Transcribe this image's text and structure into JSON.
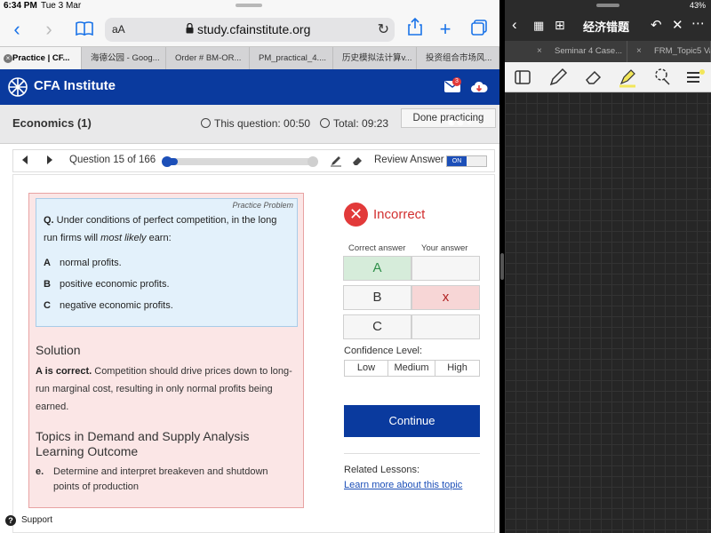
{
  "status_bar": {
    "time": "6:34 PM",
    "date": "Tue 3 Mar",
    "battery": "43%"
  },
  "browser": {
    "address_aa": "aA",
    "url": "study.cfainstitute.org",
    "tabs": [
      {
        "label": "Practice | CF..."
      },
      {
        "label": "海德公园 - Goog..."
      },
      {
        "label": "Order # BM-OR..."
      },
      {
        "label": "PM_practical_4...."
      },
      {
        "label": "历史模拟法计算v..."
      },
      {
        "label": "投资组合市场风..."
      }
    ]
  },
  "site": {
    "brand": "CFA Institute",
    "mail_badge": "3",
    "section_title": "Economics (1)",
    "this_question": "This question: 00:50",
    "total": "Total: 09:23",
    "done_label": "Done practicing"
  },
  "question_nav": {
    "label": "Question 15 of 166",
    "current": 15,
    "total": 166,
    "review_label": "Review Answer",
    "toggle_on": "ON"
  },
  "question": {
    "practice_label": "Practice Problem",
    "q_prefix": "Q.",
    "text_before": " Under conditions of perfect competition, in the long run firms will ",
    "text_em": "most likely",
    "text_after": " earn:",
    "options": [
      {
        "letter": "A",
        "text": "normal profits."
      },
      {
        "letter": "B",
        "text": "positive economic profits."
      },
      {
        "letter": "C",
        "text": "negative economic profits."
      }
    ]
  },
  "solution": {
    "title": "Solution",
    "bold": "A is correct.",
    "text": " Competition should drive prices down to long-run marginal cost, resulting in only normal profits being earned.",
    "topics_title": "Topics in Demand and Supply Analysis Learning Outcome",
    "lo_letter": "e.",
    "lo_text": "Determine and interpret breakeven and shutdown points of production"
  },
  "result": {
    "verdict": "Incorrect",
    "correct_header": "Correct answer",
    "your_header": "Your answer",
    "rows": [
      {
        "correct": "A",
        "yours": ""
      },
      {
        "correct": "B",
        "yours": "x"
      },
      {
        "correct": "C",
        "yours": ""
      }
    ],
    "confidence_label": "Confidence Level:",
    "confidence": [
      "Low",
      "Medium",
      "High"
    ],
    "continue": "Continue",
    "related": "Related Lessons:",
    "learn_more": "Learn more about this topic"
  },
  "support": "Support",
  "notes_app": {
    "title": "经济错题",
    "tabs": [
      {
        "label": "Seminar 4 Case..."
      },
      {
        "label": "FRM_Topic5 Va"
      }
    ],
    "colors": {
      "highlighter": "#f2e65a",
      "canvas": "#262626"
    }
  }
}
